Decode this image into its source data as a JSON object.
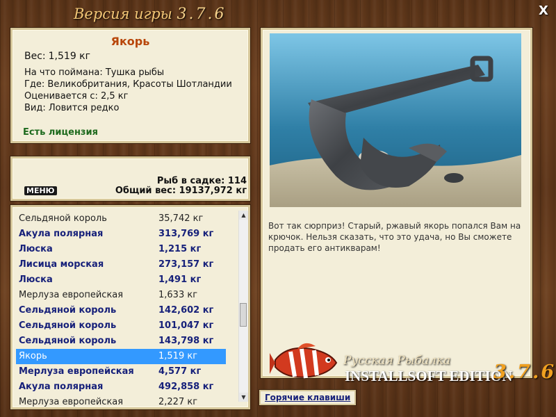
{
  "header": {
    "title_prefix": "Версия игры",
    "version": "3.7.6",
    "close_label": "X"
  },
  "info": {
    "name": "Якорь",
    "weight_label": "Вес:",
    "weight_value": "1,519 кг",
    "caught_on": "На что поймана: Тушка рыбы",
    "location": "Где: Великобритания, Красоты Шотландии",
    "estimated": "Оценивается с: 2,5 кг",
    "type": "Вид: Ловится редко",
    "license": "Есть лицензия"
  },
  "stats": {
    "menu_label": "МЕНЮ",
    "fish_count": "Рыб в садке: 114",
    "total_weight": "Общий вес: 19137,972 кг"
  },
  "catch_list": [
    {
      "name": "Сельдяной король",
      "weight": "35,742 кг",
      "style": "plain"
    },
    {
      "name": "Акула полярная",
      "weight": "313,769 кг",
      "style": "bold"
    },
    {
      "name": "Люска",
      "weight": "1,215 кг",
      "style": "bold"
    },
    {
      "name": "Лисица морская",
      "weight": "273,157 кг",
      "style": "bold"
    },
    {
      "name": "Люска",
      "weight": "1,491 кг",
      "style": "bold"
    },
    {
      "name": "Мерлуза европейская",
      "weight": "1,633 кг",
      "style": "plain"
    },
    {
      "name": "Сельдяной король",
      "weight": "142,602 кг",
      "style": "bold"
    },
    {
      "name": "Сельдяной король",
      "weight": "101,047 кг",
      "style": "bold"
    },
    {
      "name": "Сельдяной король",
      "weight": "143,798 кг",
      "style": "bold"
    },
    {
      "name": "Якорь",
      "weight": "1,519 кг",
      "style": "sel"
    },
    {
      "name": "Мерлуза европейская",
      "weight": "4,577 кг",
      "style": "bold"
    },
    {
      "name": "Акула полярная",
      "weight": "492,858 кг",
      "style": "bold"
    },
    {
      "name": "Мерлуза европейская",
      "weight": "2,227 кг",
      "style": "plain"
    }
  ],
  "description": "Вот так сюрприз! Старый, ржавый якорь попался Вам на крючок. Нельзя сказать, что это удача, но Вы сможете продать его антикварам!",
  "hotkeys_label": "Горячие клавиши",
  "brand": {
    "line1": "Русская Рыбалка",
    "line2": "INSTALLSOFT EDITION",
    "version": "3.7.6"
  },
  "icons": {
    "close": "close-icon",
    "scroll_up": "chevron-up-icon",
    "scroll_down": "chevron-down-icon"
  },
  "colors": {
    "accent_title": "#b8460a",
    "license": "#1d6a1d",
    "selection": "#3399ff",
    "list_bold": "#17217a"
  }
}
